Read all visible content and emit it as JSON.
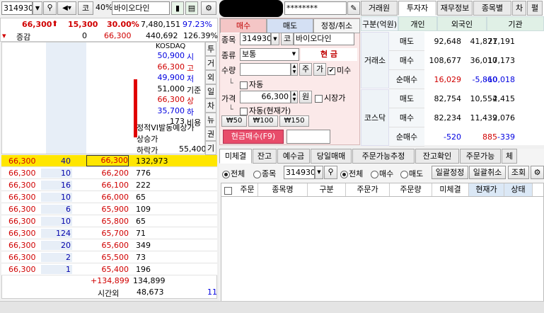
{
  "header": {
    "code": "314930",
    "market_badge": "코",
    "margin_rate": "40%",
    "stock_name": "바이오다인",
    "password_mask": "********"
  },
  "price_summary": {
    "price": "66,300",
    "change": "15,300",
    "change_rate": "30.00%",
    "volume": "7,480,151",
    "volume_rate": "97.23%",
    "label_compare": "증감",
    "compare_value": "0",
    "compare_price": "66,300",
    "amount": "440,692",
    "turnover": "126.39%"
  },
  "stock_info": {
    "market": "KOSDAQ",
    "rows": [
      {
        "value": "50,900",
        "label": "시",
        "color": "blue"
      },
      {
        "value": "66,300",
        "label": "고",
        "color": "red"
      },
      {
        "value": "49,900",
        "label": "저",
        "color": "blue"
      },
      {
        "value": "51,000",
        "label": "기준",
        "color": "black"
      },
      {
        "value": "66,300",
        "label": "상",
        "color": "red"
      },
      {
        "value": "35,700",
        "label": "하",
        "color": "blue"
      },
      {
        "value": "173",
        "label": "비용",
        "color": "black"
      }
    ],
    "vi_label": "정적VI발동예상가",
    "upper_label": "상승가",
    "lower_label": "하락가",
    "lower_value": "55,400",
    "side_tabs": [
      "투",
      "거",
      "외",
      "일",
      "차",
      "뉴",
      "권",
      "기"
    ]
  },
  "orderbook": {
    "rows": [
      {
        "left_price": "66,300",
        "left_qty": "40",
        "price": "66,300",
        "amount": "132,973",
        "highlight": true
      },
      {
        "left_price": "66,300",
        "left_qty": "10",
        "price": "66,200",
        "amount": "776"
      },
      {
        "left_price": "66,300",
        "left_qty": "16",
        "price": "66,100",
        "amount": "222"
      },
      {
        "left_price": "66,300",
        "left_qty": "10",
        "price": "66,000",
        "amount": "65"
      },
      {
        "left_price": "66,300",
        "left_qty": "6",
        "price": "65,900",
        "amount": "109"
      },
      {
        "left_price": "66,300",
        "left_qty": "10",
        "price": "65,800",
        "amount": "65"
      },
      {
        "left_price": "66,300",
        "left_qty": "124",
        "price": "65,700",
        "amount": "71"
      },
      {
        "left_price": "66,300",
        "left_qty": "20",
        "price": "65,600",
        "amount": "349"
      },
      {
        "left_price": "66,300",
        "left_qty": "2",
        "price": "65,500",
        "amount": "73"
      },
      {
        "left_price": "66,300",
        "left_qty": "1",
        "price": "65,400",
        "amount": "196"
      }
    ],
    "total_change": "+134,899",
    "total": "134,899",
    "after_hours_label": "시간외",
    "after_hours_value": "48,673",
    "after_hours_count": "11"
  },
  "order_form": {
    "tabs": [
      "매수",
      "매도",
      "정정/취소"
    ],
    "code_label": "종목",
    "code": "314930",
    "badge": "코",
    "stock_name": "바이오다인",
    "type_label": "종류",
    "type_value": "보통",
    "cash_label": "현 금",
    "qty_label": "수량",
    "qty_btn_stock": "주",
    "qty_btn_avail": "가",
    "checkbox_partial": "미수",
    "auto_label": "자동",
    "price_label": "가격",
    "price_value": "66,300",
    "price_unit": "원",
    "market_price_label": "시장가",
    "auto_current_label": "자동(현재가)",
    "tick_buttons": [
      "₩50",
      "₩100",
      "₩150"
    ],
    "submit_label": "현금매수(F9)"
  },
  "investor_panel": {
    "tabs": [
      "거래원",
      "투자자",
      "재무정보",
      "종목별",
      "차",
      "펼"
    ],
    "headers": [
      "구분(억원)",
      "개인",
      "외국인",
      "기관"
    ],
    "groups": [
      {
        "name": "거래소",
        "rows": [
          {
            "label": "매도",
            "values": [
              "92,648",
              "41,871",
              "27,191"
            ],
            "colors": [
              "black",
              "black",
              "black"
            ]
          },
          {
            "label": "매수",
            "values": [
              "108,677",
              "36,010",
              "17,173"
            ],
            "colors": [
              "black",
              "black",
              "black"
            ]
          },
          {
            "label": "순매수",
            "values": [
              "16,029",
              "-5,860",
              "-10,018"
            ],
            "colors": [
              "red",
              "blue",
              "blue"
            ]
          }
        ]
      },
      {
        "name": "코스닥",
        "rows": [
          {
            "label": "매도",
            "values": [
              "82,754",
              "10,554",
              "2,415"
            ],
            "colors": [
              "black",
              "black",
              "black"
            ]
          },
          {
            "label": "매수",
            "values": [
              "82,234",
              "11,439",
              "2,076"
            ],
            "colors": [
              "black",
              "black",
              "black"
            ]
          },
          {
            "label": "순매수",
            "values": [
              "-520",
              "885",
              "-339"
            ],
            "colors": [
              "blue",
              "red",
              "blue"
            ]
          }
        ]
      }
    ]
  },
  "bottom_panel": {
    "tabs": [
      "미체결",
      "잔고",
      "예수금",
      "당일매매",
      "주문가능추정",
      "잔고확인",
      "주문가능",
      "체"
    ],
    "filter1": [
      "전체",
      "종목"
    ],
    "filter_code": "314930",
    "filter2": [
      "전체",
      "매수",
      "매도"
    ],
    "btn_cancel_mod": "일괄정정",
    "btn_cancel_all": "일괄취소",
    "btn_query": "조회",
    "columns": [
      "주문",
      "종목명",
      "구분",
      "주문가",
      "주문량",
      "미체결",
      "현재가",
      "상태"
    ]
  }
}
